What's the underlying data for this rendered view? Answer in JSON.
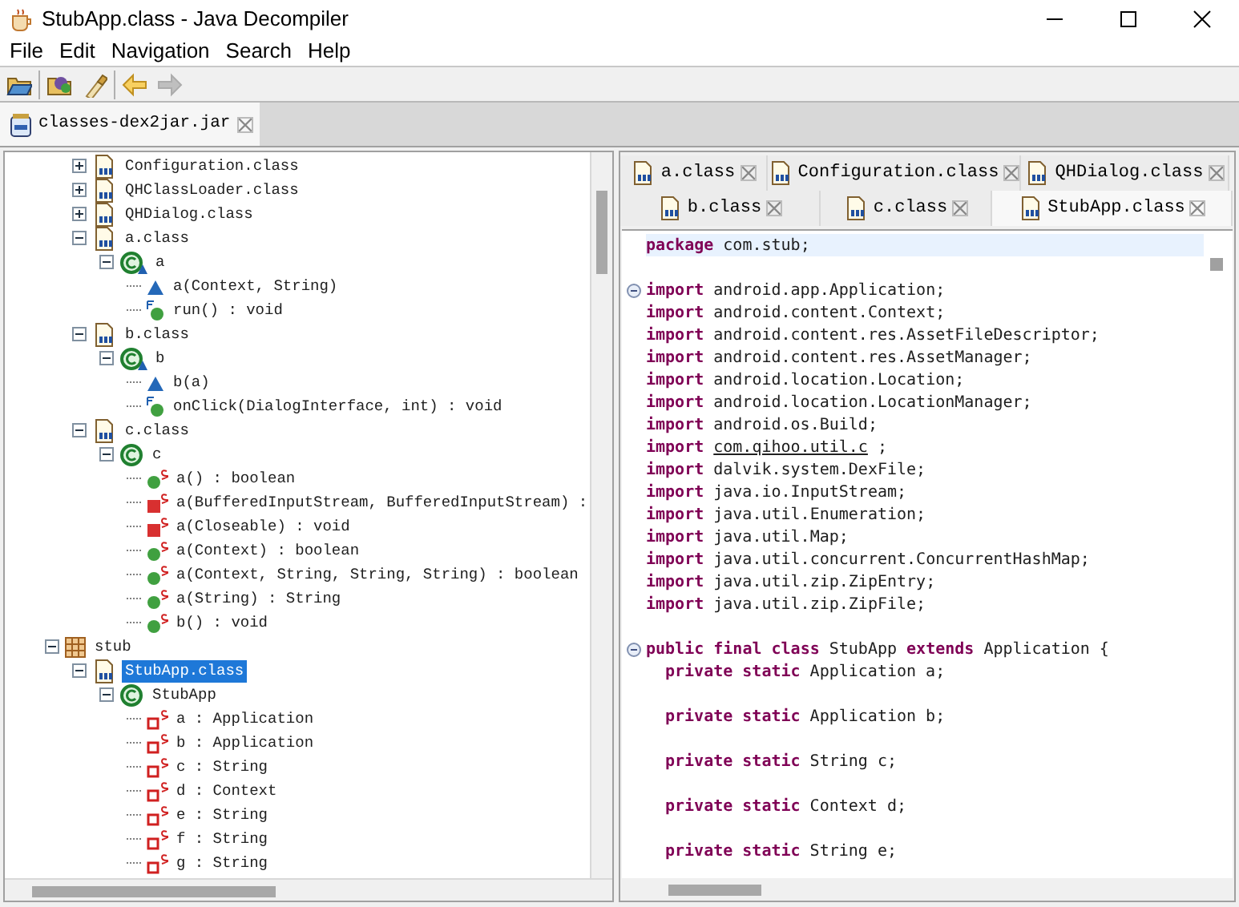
{
  "window": {
    "title": "StubApp.class - Java Decompiler"
  },
  "menu": [
    "File",
    "Edit",
    "Navigation",
    "Search",
    "Help"
  ],
  "toolbar": [
    {
      "kind": "open-file",
      "disabled": false
    },
    {
      "kind": "open-type",
      "disabled": false
    },
    {
      "kind": "search",
      "disabled": false
    },
    {
      "kind": "back",
      "disabled": false
    },
    {
      "kind": "forward",
      "disabled": true
    }
  ],
  "file_tabs": [
    {
      "label": "classes-dex2jar.jar",
      "selected": true
    }
  ],
  "tree": [
    {
      "kind": "hidden-package",
      "children": [
        {
          "kind": "classfile",
          "label": "Configuration.class",
          "expanded": false,
          "selected": false
        },
        {
          "kind": "classfile",
          "label": "QHClassLoader.class",
          "expanded": false,
          "selected": false
        },
        {
          "kind": "classfile",
          "label": "QHDialog.class",
          "expanded": false,
          "selected": false
        },
        {
          "kind": "classfile",
          "label": "a.class",
          "expanded": true,
          "selected": false,
          "children": [
            {
              "kind": "final-class",
              "label": "a",
              "expanded": true,
              "selected": false,
              "children": [
                {
                  "kind": "constructor",
                  "label": "a(Context, String)",
                  "selected": false
                },
                {
                  "kind": "final-method",
                  "label": "run() : void",
                  "selected": false
                }
              ]
            }
          ]
        },
        {
          "kind": "classfile",
          "label": "b.class",
          "expanded": true,
          "selected": false,
          "children": [
            {
              "kind": "final-class",
              "label": "b",
              "expanded": true,
              "selected": false,
              "children": [
                {
                  "kind": "constructor",
                  "label": "b(a)",
                  "selected": false
                },
                {
                  "kind": "final-method",
                  "label": "onClick(DialogInterface, int) : void",
                  "selected": false
                }
              ]
            }
          ]
        },
        {
          "kind": "classfile",
          "label": "c.class",
          "expanded": true,
          "selected": false,
          "children": [
            {
              "kind": "class",
              "label": "c",
              "expanded": true,
              "selected": false,
              "children": [
                {
                  "kind": "static-method",
                  "label": "a() : boolean",
                  "selected": false
                },
                {
                  "kind": "static-private-method",
                  "label": "a(BufferedInputStream, BufferedInputStream) :",
                  "selected": false
                },
                {
                  "kind": "static-private-method",
                  "label": "a(Closeable) : void",
                  "selected": false
                },
                {
                  "kind": "static-method",
                  "label": "a(Context) : boolean",
                  "selected": false
                },
                {
                  "kind": "static-method",
                  "label": "a(Context, String, String, String) : boolean",
                  "selected": false
                },
                {
                  "kind": "static-method",
                  "label": "a(String) : String",
                  "selected": false
                },
                {
                  "kind": "static-method",
                  "label": "b() : void",
                  "selected": false
                }
              ]
            }
          ]
        }
      ]
    },
    {
      "kind": "package",
      "label": "stub",
      "expanded": true,
      "selected": false,
      "children": [
        {
          "kind": "classfile",
          "label": "StubApp.class",
          "expanded": true,
          "selected": true,
          "children": [
            {
              "kind": "class",
              "label": "StubApp",
              "expanded": true,
              "selected": false,
              "children": [
                {
                  "kind": "static-field",
                  "label": "a : Application",
                  "selected": false
                },
                {
                  "kind": "static-field",
                  "label": "b : Application",
                  "selected": false
                },
                {
                  "kind": "static-field",
                  "label": "c : String",
                  "selected": false
                },
                {
                  "kind": "static-field",
                  "label": "d : Context",
                  "selected": false
                },
                {
                  "kind": "static-field",
                  "label": "e : String",
                  "selected": false
                },
                {
                  "kind": "static-field",
                  "label": "f : String",
                  "selected": false
                },
                {
                  "kind": "static-field",
                  "label": "g : String",
                  "selected": false
                }
              ]
            }
          ]
        }
      ]
    }
  ],
  "editor_tabs": [
    [
      {
        "label": "a.class",
        "selected": false
      },
      {
        "label": "Configuration.class",
        "selected": false
      },
      {
        "label": "QHDialog.class",
        "selected": false
      }
    ],
    [
      {
        "label": "b.class",
        "selected": false
      },
      {
        "label": "c.class",
        "selected": false
      },
      {
        "label": "StubApp.class",
        "selected": true
      }
    ]
  ],
  "code": [
    {
      "current": true,
      "fold": false,
      "indented": false,
      "tokens": [
        {
          "kind": "keyword",
          "text": "package"
        },
        {
          "kind": "plain",
          "text": "com.stub;"
        }
      ]
    },
    {
      "current": false,
      "fold": false
    },
    {
      "current": false,
      "fold": true,
      "indented": false,
      "tokens": [
        {
          "kind": "keyword",
          "text": "import"
        },
        {
          "kind": "plain",
          "text": "android.app.Application;"
        }
      ]
    },
    {
      "current": false,
      "fold": false,
      "indented": false,
      "tokens": [
        {
          "kind": "keyword",
          "text": "import"
        },
        {
          "kind": "plain",
          "text": "android.content.Context;"
        }
      ]
    },
    {
      "current": false,
      "fold": false,
      "indented": false,
      "tokens": [
        {
          "kind": "keyword",
          "text": "import"
        },
        {
          "kind": "plain",
          "text": "android.content.res.AssetFileDescriptor;"
        }
      ]
    },
    {
      "current": false,
      "fold": false,
      "indented": false,
      "tokens": [
        {
          "kind": "keyword",
          "text": "import"
        },
        {
          "kind": "plain",
          "text": "android.content.res.AssetManager;"
        }
      ]
    },
    {
      "current": false,
      "fold": false,
      "indented": false,
      "tokens": [
        {
          "kind": "keyword",
          "text": "import"
        },
        {
          "kind": "plain",
          "text": "android.location.Location;"
        }
      ]
    },
    {
      "current": false,
      "fold": false,
      "indented": false,
      "tokens": [
        {
          "kind": "keyword",
          "text": "import"
        },
        {
          "kind": "plain",
          "text": "android.location.LocationManager;"
        }
      ]
    },
    {
      "current": false,
      "fold": false,
      "indented": false,
      "tokens": [
        {
          "kind": "keyword",
          "text": "import"
        },
        {
          "kind": "plain",
          "text": "android.os.Build;"
        }
      ]
    },
    {
      "current": false,
      "fold": false,
      "indented": false,
      "tokens": [
        {
          "kind": "keyword",
          "text": "import"
        },
        {
          "kind": "link",
          "text": "com.qihoo.util.c"
        },
        {
          "kind": "plain",
          "text": ";"
        }
      ]
    },
    {
      "current": false,
      "fold": false,
      "indented": false,
      "tokens": [
        {
          "kind": "keyword",
          "text": "import"
        },
        {
          "kind": "plain",
          "text": "dalvik.system.DexFile;"
        }
      ]
    },
    {
      "current": false,
      "fold": false,
      "indented": false,
      "tokens": [
        {
          "kind": "keyword",
          "text": "import"
        },
        {
          "kind": "plain",
          "text": "java.io.InputStream;"
        }
      ]
    },
    {
      "current": false,
      "fold": false,
      "indented": false,
      "tokens": [
        {
          "kind": "keyword",
          "text": "import"
        },
        {
          "kind": "plain",
          "text": "java.util.Enumeration;"
        }
      ]
    },
    {
      "current": false,
      "fold": false,
      "indented": false,
      "tokens": [
        {
          "kind": "keyword",
          "text": "import"
        },
        {
          "kind": "plain",
          "text": "java.util.Map;"
        }
      ]
    },
    {
      "current": false,
      "fold": false,
      "indented": false,
      "tokens": [
        {
          "kind": "keyword",
          "text": "import"
        },
        {
          "kind": "plain",
          "text": "java.util.concurrent.ConcurrentHashMap;"
        }
      ]
    },
    {
      "current": false,
      "fold": false,
      "indented": false,
      "tokens": [
        {
          "kind": "keyword",
          "text": "import"
        },
        {
          "kind": "plain",
          "text": "java.util.zip.ZipEntry;"
        }
      ]
    },
    {
      "current": false,
      "fold": false,
      "indented": false,
      "tokens": [
        {
          "kind": "keyword",
          "text": "import"
        },
        {
          "kind": "plain",
          "text": "java.util.zip.ZipFile;"
        }
      ]
    },
    {
      "current": false,
      "fold": false
    },
    {
      "current": false,
      "fold": true,
      "indented": false,
      "tokens": [
        {
          "kind": "keyword",
          "text": "public final class"
        },
        {
          "kind": "plain",
          "text": "StubApp"
        },
        {
          "kind": "keyword",
          "text": "extends"
        },
        {
          "kind": "plain",
          "text": "Application {"
        }
      ]
    },
    {
      "current": false,
      "fold": false,
      "indented": true,
      "tokens": [
        {
          "kind": "keyword",
          "text": "private static"
        },
        {
          "kind": "plain",
          "text": "Application a;"
        }
      ]
    },
    {
      "current": false,
      "fold": false
    },
    {
      "current": false,
      "fold": false,
      "indented": true,
      "tokens": [
        {
          "kind": "keyword",
          "text": "private static"
        },
        {
          "kind": "plain",
          "text": "Application b;"
        }
      ]
    },
    {
      "current": false,
      "fold": false
    },
    {
      "current": false,
      "fold": false,
      "indented": true,
      "tokens": [
        {
          "kind": "keyword",
          "text": "private static"
        },
        {
          "kind": "plain",
          "text": "String c;"
        }
      ]
    },
    {
      "current": false,
      "fold": false
    },
    {
      "current": false,
      "fold": false,
      "indented": true,
      "tokens": [
        {
          "kind": "keyword",
          "text": "private static"
        },
        {
          "kind": "plain",
          "text": "Context d;"
        }
      ]
    },
    {
      "current": false,
      "fold": false
    },
    {
      "current": false,
      "fold": false,
      "indented": true,
      "tokens": [
        {
          "kind": "keyword",
          "text": "private static"
        },
        {
          "kind": "plain",
          "text": "String e;"
        }
      ]
    }
  ]
}
